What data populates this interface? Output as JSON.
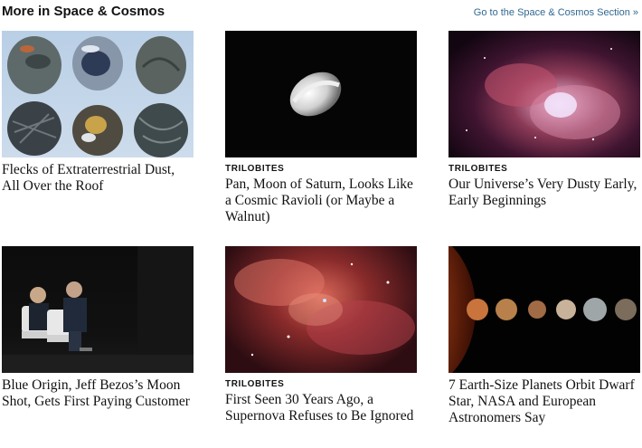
{
  "section": {
    "title": "More in Space & Cosmos",
    "link": "Go to the Space & Cosmos Section »"
  },
  "cards": [
    {
      "kicker": "",
      "headline": "Flecks of Extraterrestrial Dust, All Over the Roof",
      "image": "micrometeorite grains"
    },
    {
      "kicker": "TRILOBITES",
      "headline": "Pan, Moon of Saturn, Looks Like a Cosmic Ravioli (or Maybe a Walnut)",
      "image": "moon Pan"
    },
    {
      "kicker": "TRILOBITES",
      "headline": "Our Universe’s Very Dusty Early, Early Beginnings",
      "image": "nebula"
    },
    {
      "kicker": "",
      "headline": "Blue Origin, Jeff Bezos’s Moon Shot, Gets First Paying Customer",
      "image": "two men on stage"
    },
    {
      "kicker": "TRILOBITES",
      "headline": "First Seen 30 Years Ago, a Supernova Refuses to Be Ignored",
      "image": "supernova remnant"
    },
    {
      "kicker": "",
      "headline": "7 Earth-Size Planets Orbit Dwarf Star, NASA and European Astronomers Say",
      "image": "row of planets"
    }
  ]
}
